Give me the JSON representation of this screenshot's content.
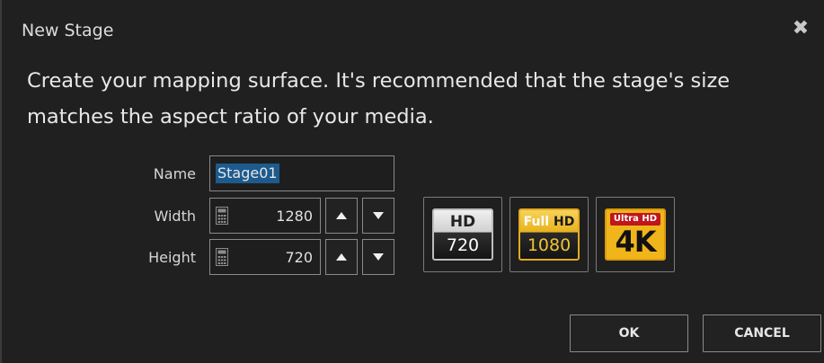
{
  "dialog": {
    "title": "New Stage",
    "close_glyph": "✖",
    "description": "Create your mapping surface. It's recommended that the stage's size matches the aspect ratio of your media."
  },
  "form": {
    "name_label": "Name",
    "name_value": "Stage01",
    "width_label": "Width",
    "width_value": "1280",
    "height_label": "Height",
    "height_value": "720",
    "icons": {
      "field_icon": "calculator-icon",
      "increment_icon": "arrow-up-icon",
      "decrement_icon": "arrow-down-icon"
    }
  },
  "presets": [
    {
      "name": "hd-720",
      "top": "HD",
      "bottom": "720"
    },
    {
      "name": "full-hd-1080",
      "top_a": "Full ",
      "top_b": "HD",
      "bottom": "1080"
    },
    {
      "name": "ultra-hd-4k",
      "top": "Ultra HD",
      "bottom": "4K"
    }
  ],
  "actions": {
    "ok_label": "OK",
    "cancel_label": "CANCEL"
  },
  "colors": {
    "background": "#202020",
    "selection": "#1d5a8e",
    "gold": "#f0b51a",
    "red": "#c0161b"
  }
}
